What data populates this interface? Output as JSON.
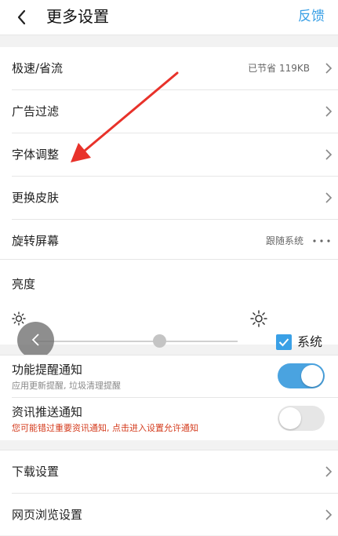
{
  "colors": {
    "accent": "#3aa0e6",
    "toggle_on": "#4aa3e0",
    "toggle_off": "#e6e6e6",
    "warning": "#d43c1e",
    "annotation_arrow": "#e8322a"
  },
  "header": {
    "title": "更多设置",
    "feedback_label": "反馈",
    "back_icon": "chevron-left-icon"
  },
  "settings_group_1": {
    "items": [
      {
        "label": "极速/省流",
        "value": "已节省 119KB"
      },
      {
        "label": "广告过滤"
      },
      {
        "label": "字体调整"
      },
      {
        "label": "更换皮肤"
      },
      {
        "label": "旋转屏幕",
        "value": "跟随系统"
      }
    ]
  },
  "brightness": {
    "label": "亮度",
    "level": 0.62,
    "system_label": "系统",
    "system_checked": true
  },
  "notifications": {
    "items": [
      {
        "title": "功能提醒通知",
        "subtitle": "应用更新提醒, 垃圾清理提醒",
        "enabled": true
      },
      {
        "title": "资讯推送通知",
        "subtitle": "您可能错过重要资讯通知, 点击进入设置允许通知",
        "enabled": false
      }
    ]
  },
  "settings_group_2": {
    "items": [
      {
        "label": "下载设置"
      },
      {
        "label": "网页浏览设置"
      }
    ]
  }
}
